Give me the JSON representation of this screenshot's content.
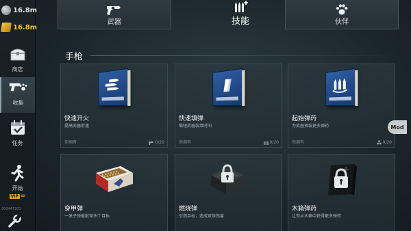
{
  "resources": {
    "silver_distance": "16.8m",
    "gold_distance": "16.8m"
  },
  "sidebar": {
    "items": [
      {
        "label": "商店",
        "icon": "chest-icon"
      },
      {
        "label": "收集",
        "icon": "gun-paw-icon"
      },
      {
        "label": "任务",
        "icon": "calendar-check-icon"
      },
      {
        "label": "开始",
        "icon": "running-man-icon"
      }
    ],
    "vip_badge": "VIP",
    "vip_value": "∞",
    "player_id": "300447301",
    "settings_icon": "wrench-icon"
  },
  "tabs": [
    {
      "label": "武器",
      "icon": "revolver-icon"
    },
    {
      "label": "技能",
      "icon": "bullets-plus-icon"
    },
    {
      "label": "伙伴",
      "icon": "paw-icon"
    }
  ],
  "section": {
    "title": "手枪"
  },
  "cards": [
    {
      "name": "快速开火",
      "desc": "提高武器射速",
      "owned": "你拥有",
      "count": "0/20",
      "count_icon": "gun-icon",
      "image": "book-bullets"
    },
    {
      "name": "快速填弹",
      "desc": "缩短武器装填时间",
      "owned": "你拥有",
      "count": "0/20",
      "count_icon": "bullets-icon",
      "image": "book-magazine"
    },
    {
      "name": "起始弹药",
      "desc": "为武器预装更多弹药",
      "owned": "你拥有",
      "count": "0/20",
      "count_icon": "ammo-stack-icon",
      "image": "book-rounds"
    },
    {
      "name": "穿甲弹",
      "desc": "一发子弹能射穿多个目标",
      "image": "ammo-box"
    },
    {
      "name": "燃烧弹",
      "desc": "引燃目标，造成双倍伤害",
      "image": "locked-box-dark"
    },
    {
      "name": "木箱弹药",
      "desc": "让你从木箱中获得更多弹药",
      "image": "locked-box-black"
    }
  ],
  "mod_badge": "Mod",
  "colors": {
    "gold": "#f0c13a",
    "book_blue": "#2f5ea3",
    "background": "#1b262a"
  }
}
